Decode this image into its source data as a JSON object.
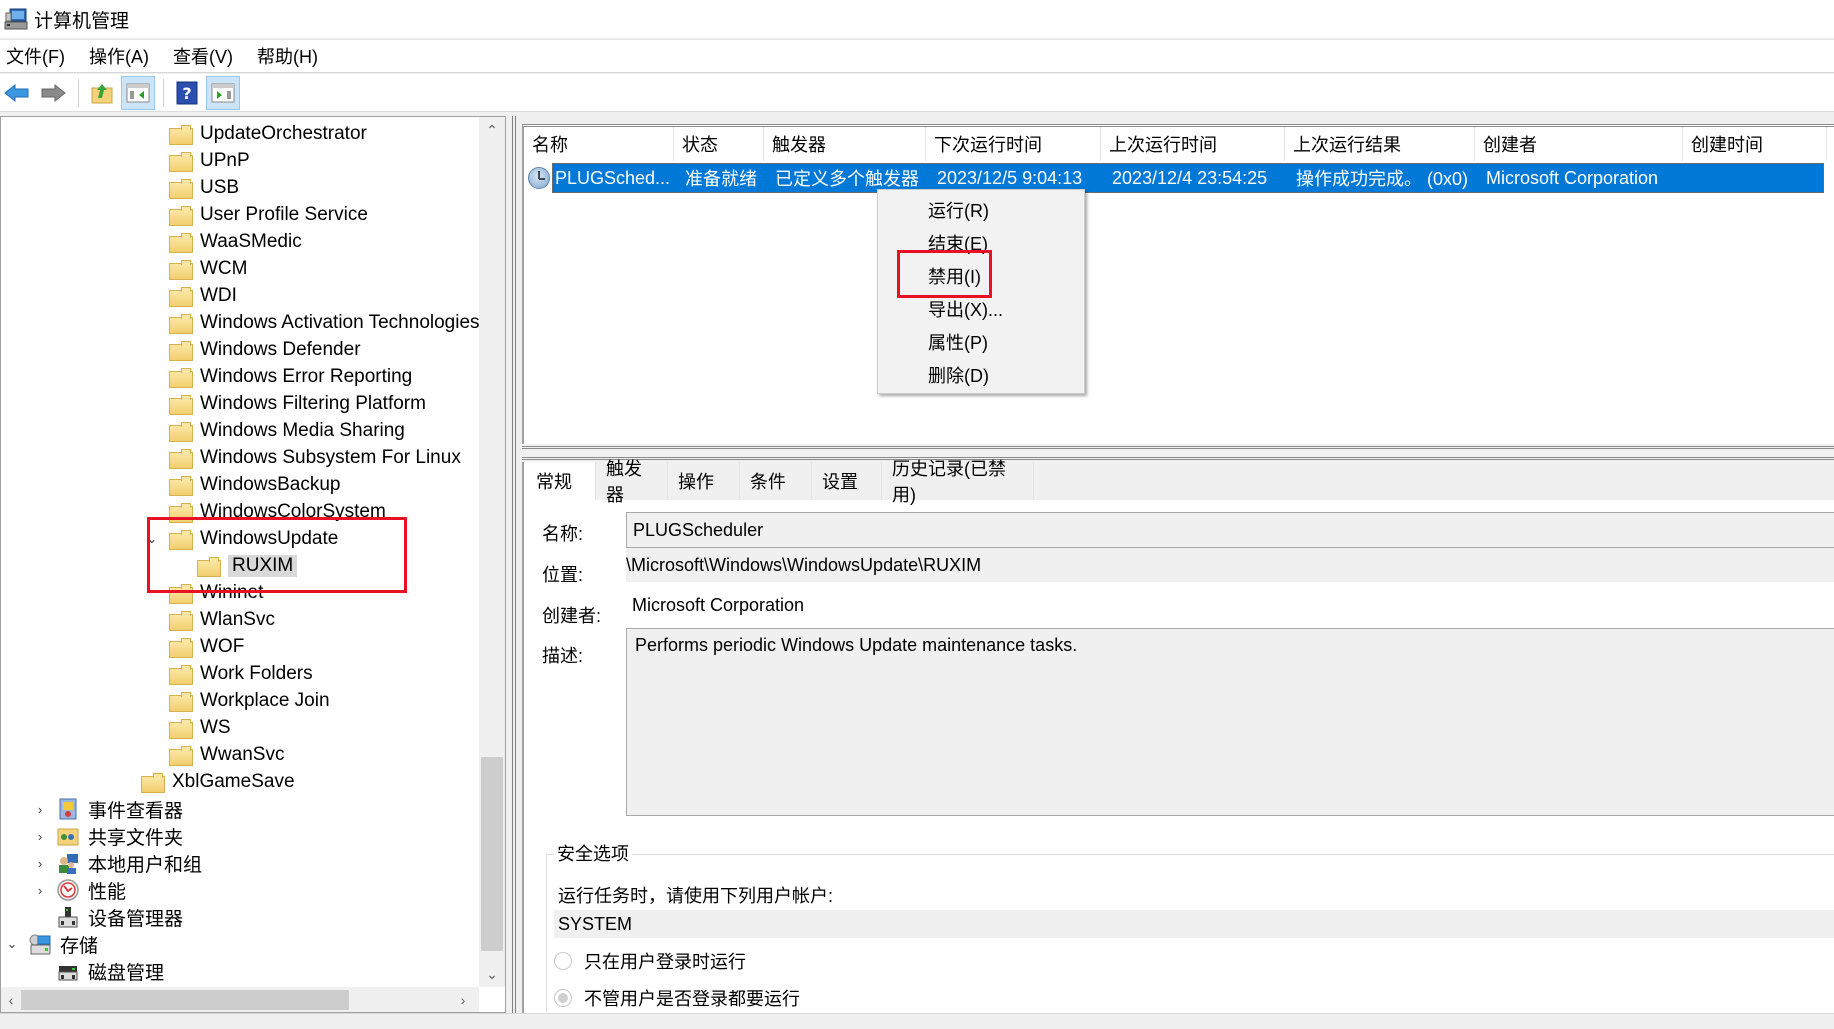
{
  "window": {
    "title": "计算机管理",
    "app_icon": "computer-management-icon"
  },
  "menubar": {
    "items": [
      "文件(F)",
      "操作(A)",
      "查看(V)",
      "帮助(H)"
    ]
  },
  "toolbar": {
    "buttons": [
      {
        "icon": "back-arrow-icon",
        "pressed": false
      },
      {
        "icon": "forward-arrow-icon",
        "pressed": false
      },
      {
        "icon": "up-folder-icon",
        "pressed": false
      },
      {
        "icon": "show-hide-console-tree-icon",
        "pressed": true
      },
      {
        "icon": "help-icon",
        "pressed": false
      },
      {
        "icon": "show-hide-action-pane-icon",
        "pressed": true
      }
    ]
  },
  "tree": {
    "folders": [
      "UpdateOrchestrator",
      "UPnP",
      "USB",
      "User Profile Service",
      "WaaSMedic",
      "WCM",
      "WDI",
      "Windows Activation Technologies",
      "Windows Defender",
      "Windows Error Reporting",
      "Windows Filtering Platform",
      "Windows Media Sharing",
      "Windows Subsystem For Linux",
      "WindowsBackup",
      "WindowsColorSystem",
      "WindowsUpdate",
      "RUXIM",
      "Wininet",
      "WlanSvc",
      "WOF",
      "Work Folders",
      "Workplace Join",
      "WS",
      "WwanSvc",
      "XblGameSave"
    ],
    "expanded_folder": "WindowsUpdate",
    "selected_folder": "RUXIM",
    "system_tools": [
      {
        "label": "事件查看器",
        "icon": "event-viewer-icon",
        "expandable": true
      },
      {
        "label": "共享文件夹",
        "icon": "shared-folders-icon",
        "expandable": true
      },
      {
        "label": "本地用户和组",
        "icon": "local-users-groups-icon",
        "expandable": true
      },
      {
        "label": "性能",
        "icon": "performance-icon",
        "expandable": true
      },
      {
        "label": "设备管理器",
        "icon": "device-manager-icon",
        "expandable": false
      }
    ],
    "storage": {
      "label": "存储",
      "expanded": true
    },
    "disk_management": "磁盘管理"
  },
  "task_list": {
    "columns": [
      "名称",
      "状态",
      "触发器",
      "下次运行时间",
      "上次运行时间",
      "上次运行结果",
      "创建者",
      "创建时间"
    ],
    "rows": [
      {
        "name": "PLUGSched...",
        "status": "准备就绪",
        "triggers": "已定义多个触发器",
        "next_run": "2023/12/5 9:04:13",
        "last_run": "2023/12/4 23:54:25",
        "last_result": "操作成功完成。 (0x0)",
        "author": "Microsoft Corporation",
        "created": ""
      }
    ]
  },
  "context_menu": {
    "items": [
      "运行(R)",
      "结束(E)",
      "禁用(I)",
      "导出(X)...",
      "属性(P)",
      "删除(D)"
    ],
    "highlighted": "禁用(I)"
  },
  "detail": {
    "tabs": [
      "常规",
      "触发器",
      "操作",
      "条件",
      "设置",
      "历史记录(已禁用)"
    ],
    "active_tab": "常规",
    "name_label": "名称:",
    "name_value": "PLUGScheduler",
    "location_label": "位置:",
    "location_value": "\\Microsoft\\Windows\\WindowsUpdate\\RUXIM",
    "author_label": "创建者:",
    "author_value": "Microsoft Corporation",
    "description_label": "描述:",
    "description_value": "Performs periodic Windows Update maintenance tasks.",
    "security": {
      "group_title": "安全选项",
      "account_prompt": "运行任务时，请使用下列用户帐户:",
      "account": "SYSTEM",
      "radio_logged_on_only": "只在用户登录时运行",
      "radio_whether_logged_on": "不管用户是否登录都要运行",
      "selected_radio": "不管用户是否登录都要运行"
    }
  },
  "colors": {
    "selection": "#0078d7",
    "highlight_box": "#e81123",
    "tree_selected_bg": "#d9d9d9"
  }
}
